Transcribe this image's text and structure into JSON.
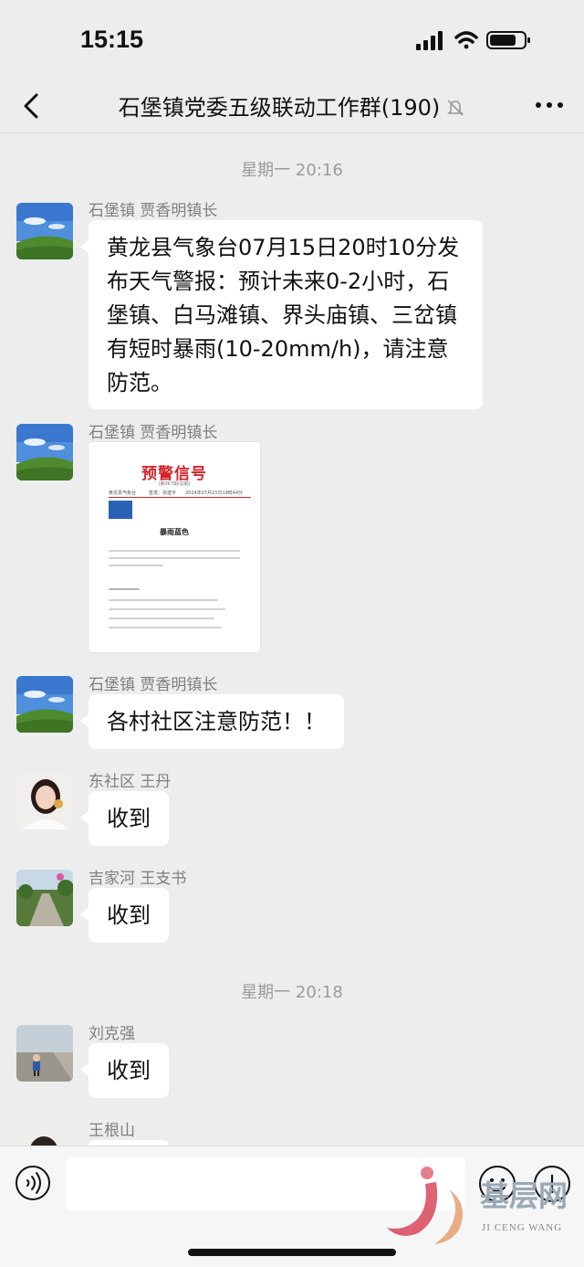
{
  "status_bar": {
    "time": "15:15"
  },
  "header": {
    "title": "石堡镇党委五级联动工作群(190)"
  },
  "messages": [
    {
      "timestamp": "星期一 20:16"
    },
    {
      "sender": "石堡镇 贾香明镇长",
      "text": "黄龙县气象台07月15日20时10分发布天气警报：预计未来0-2小时，石堡镇、白马滩镇、界头庙镇、三岔镇有短时暴雨(10-20mm/h)，请注意防范。"
    },
    {
      "sender": "石堡镇 贾香明镇长",
      "doc": {
        "heading": "预警信号",
        "subheading": "(第367期/总期)",
        "org": "黄龙县气象台",
        "issuer": "签发：张建平",
        "date": "2024年07月15日19时44分",
        "subtitle": "暴雨蓝色"
      }
    },
    {
      "sender": "石堡镇 贾香明镇长",
      "text": "各村社区注意防范！！"
    },
    {
      "sender": "东社区 王丹",
      "text": "收到"
    },
    {
      "sender": "吉家河 王支书",
      "text": "收到"
    },
    {
      "timestamp": "星期一 20:18"
    },
    {
      "sender": "刘克强",
      "text": "收到"
    },
    {
      "sender": "王根山",
      "text": ""
    }
  ],
  "watermark": {
    "name": "基层网",
    "latin": "JI CENG WANG"
  },
  "icons": {
    "back": "chevron-left-icon",
    "mute": "bell-slash-icon",
    "more": "ellipsis-icon",
    "voice": "voice-icon",
    "emoji": "smile-icon",
    "plus": "plus-icon"
  },
  "colors": {
    "background": "#ededed",
    "bubble": "#ffffff",
    "warning_red": "#d3262a"
  }
}
